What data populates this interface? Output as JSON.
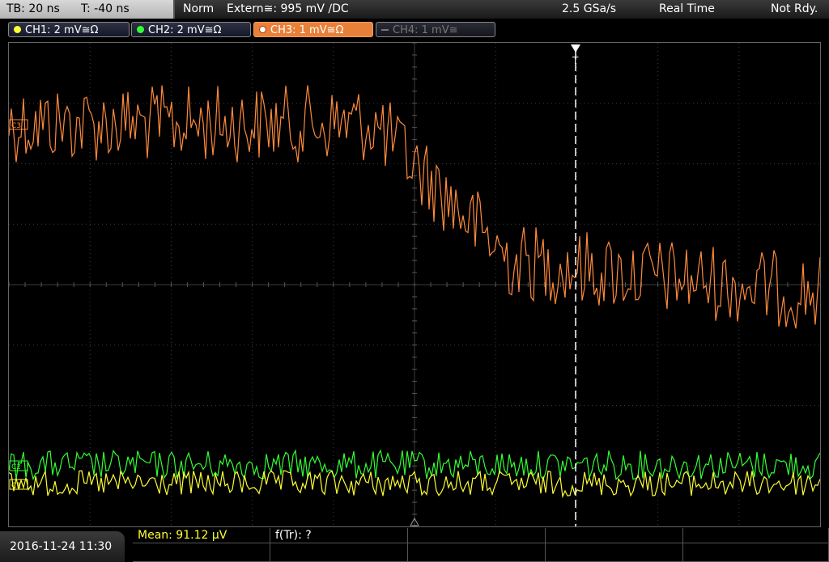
{
  "timebase": {
    "tb": "TB: 20 ns",
    "t": "T: -40 ns"
  },
  "status": {
    "mode": "Norm",
    "trigger": "Extern≅: 995 mV ∕DC",
    "rate": "2.5 GSa/s",
    "acq": "Real Time",
    "ready": "Not Rdy."
  },
  "channels": [
    {
      "label": "CH1: 2 mV≅Ω",
      "color": "#ffff33",
      "state": "on"
    },
    {
      "label": "CH2: 2 mV≅Ω",
      "color": "#33ff33",
      "state": "on"
    },
    {
      "label": "CH3: 1 mV≅Ω",
      "color": "#e8803a",
      "state": "active"
    },
    {
      "label": "CH4: 1 mV≅",
      "color": "#777777",
      "state": "off"
    }
  ],
  "markers": {
    "ch3": "C3",
    "ch2": "C2",
    "ch1": "C1",
    "trigger": "T"
  },
  "datetime": "2016-11-24 11:30",
  "measurements": {
    "mean": "Mean: 91.12 µV",
    "ftr": "f(Tr): ?"
  },
  "colors": {
    "ch1": "#ffff33",
    "ch2": "#33ff33",
    "ch3": "#ff8a3c",
    "grid": "#3c3c3c"
  }
}
